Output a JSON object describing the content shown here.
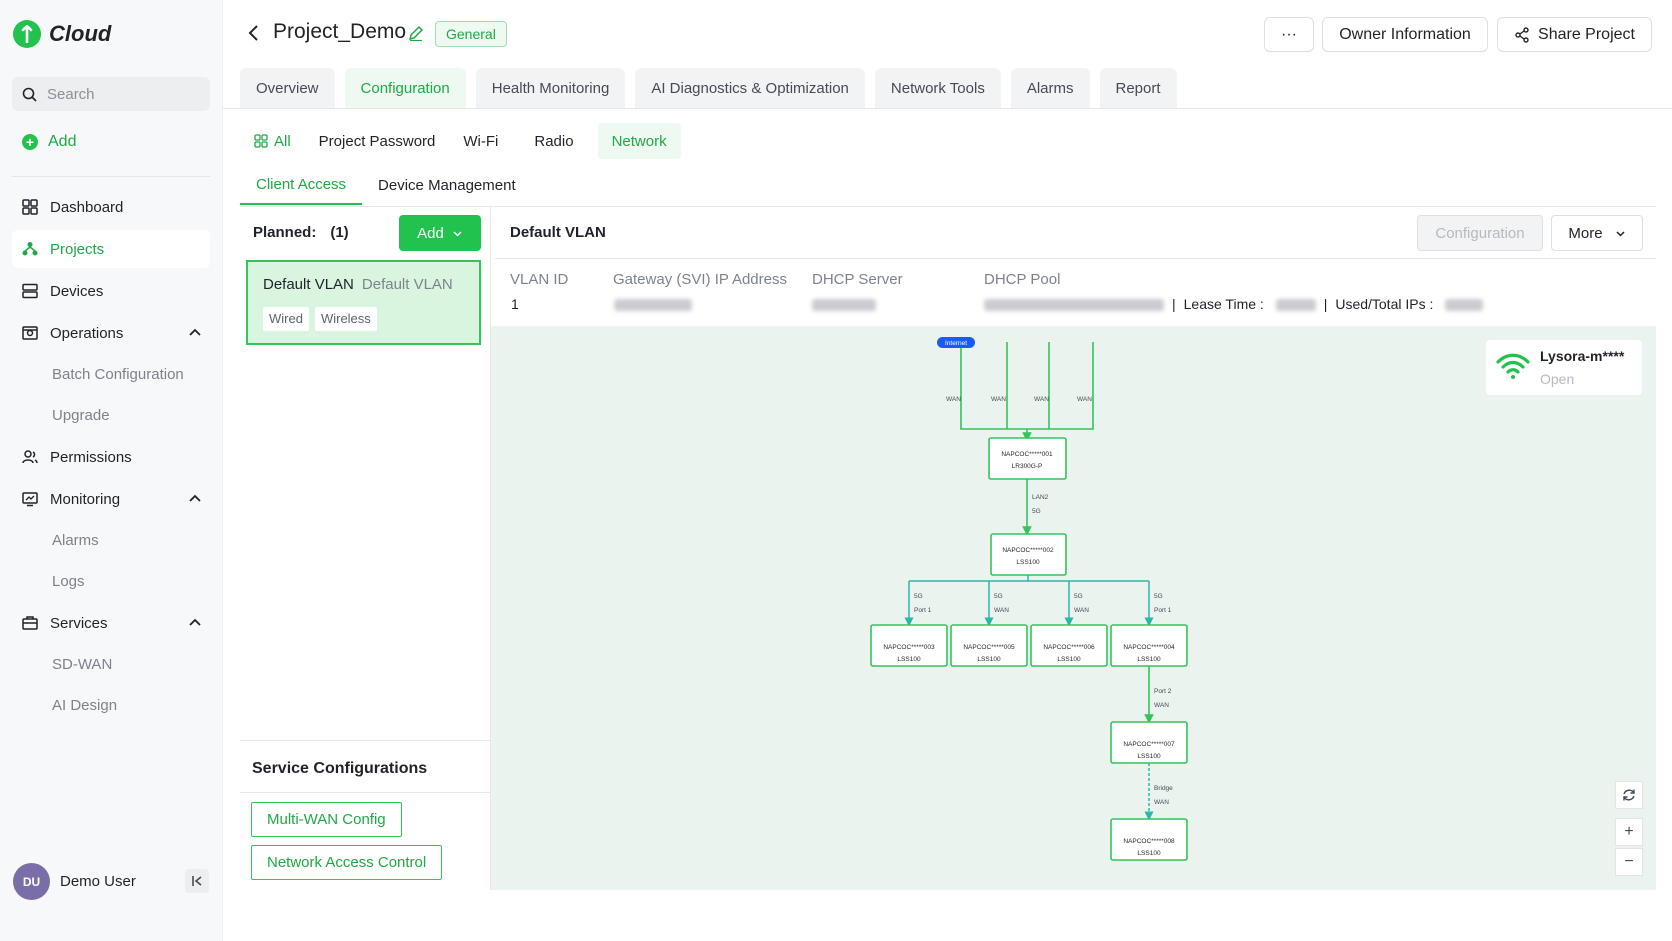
{
  "brand": {
    "name": "Cloud",
    "accent": "#22c24f"
  },
  "sidebar": {
    "search_placeholder": "Search",
    "add_label": "Add",
    "items": {
      "dashboard": "Dashboard",
      "projects": "Projects",
      "devices": "Devices",
      "operations": "Operations",
      "batch_configuration": "Batch Configuration",
      "upgrade": "Upgrade",
      "permissions": "Permissions",
      "monitoring": "Monitoring",
      "alarms": "Alarms",
      "logs": "Logs",
      "services": "Services",
      "sd_wan": "SD-WAN",
      "ai_design": "AI Design"
    },
    "user": {
      "initials": "DU",
      "name": "Demo User"
    }
  },
  "header": {
    "project_name": "Project_Demo",
    "badge": "General",
    "more_label": "···",
    "owner_label": "Owner Information",
    "share_label": "Share Project"
  },
  "tabs": [
    "Overview",
    "Configuration",
    "Health Monitoring",
    "AI Diagnostics & Optimization",
    "Network Tools",
    "Alarms",
    "Report"
  ],
  "active_tab": "Configuration",
  "subtabs": [
    "All",
    "Project Password",
    "Wi-Fi",
    "Radio",
    "Network"
  ],
  "subtabs2": [
    "Client Access",
    "Device Management"
  ],
  "left_panel": {
    "planned_label": "Planned:",
    "planned_count": "(1)",
    "add_label": "Add",
    "vlan_card": {
      "name": "Default VLAN",
      "desc": "Default VLAN",
      "chips": [
        "Wired",
        "Wireless"
      ]
    },
    "service_title": "Service Configurations",
    "service_buttons": [
      "Multi-WAN Config",
      "Network Access Control"
    ]
  },
  "vlan_detail": {
    "title": "Default VLAN",
    "configuration_label": "Configuration",
    "more_label": "More",
    "columns": {
      "vlan_id": "VLAN ID",
      "gateway": "Gateway (SVI) IP Address",
      "dhcp_server": "DHCP Server",
      "dhcp_pool": "DHCP Pool"
    },
    "vlan_id_value": "1",
    "lease_time_label": "Lease Time :",
    "used_ips_label": "Used/Total IPs :"
  },
  "wifi": {
    "ssid": "Lysora-m****",
    "status": "Open"
  },
  "topology": {
    "internet_label": "Internet",
    "wan_label": "WAN",
    "nodes": {
      "n1": {
        "name": "NAPCOC*****001",
        "model": "LR300G-P"
      },
      "n2": {
        "name": "NAPCOC*****002",
        "model": "LSS100"
      },
      "n3": {
        "name": "NAPCOC*****003",
        "model": "LSS100"
      },
      "n5": {
        "name": "NAPCOC*****005",
        "model": "LSS100"
      },
      "n6": {
        "name": "NAPCOC*****006",
        "model": "LSS100"
      },
      "n4": {
        "name": "NAPCOC*****004",
        "model": "LSS100"
      },
      "n7": {
        "name": "NAPCOC*****007",
        "model": "LSS100"
      },
      "n8": {
        "name": "NAPCOC*****008",
        "model": "LSS100"
      }
    },
    "links": {
      "l12_a": "LAN2",
      "l12_b": "5G",
      "l23_a": "5G",
      "l23_b": "Port 1",
      "l25_a": "5G",
      "l25_b": "WAN",
      "l26_a": "5G",
      "l26_b": "WAN",
      "l24_a": "5G",
      "l24_b": "Port 1",
      "l47_a": "Port 2",
      "l47_b": "WAN",
      "l78_a": "Bridge",
      "l78_b": "WAN"
    }
  },
  "controls": {
    "zoom_in": "+",
    "zoom_out": "−"
  }
}
